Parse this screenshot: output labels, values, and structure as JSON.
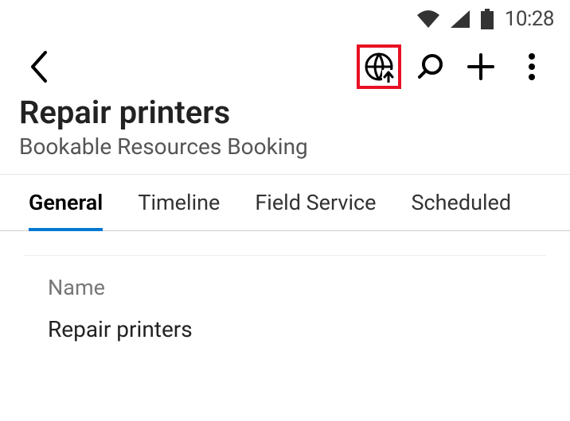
{
  "status_bar": {
    "time": "10:28"
  },
  "app_bar": {
    "icons": {
      "back": "back-icon",
      "sync": "globe-upload-icon",
      "search": "search-icon",
      "add": "plus-icon",
      "overflow": "overflow-icon"
    }
  },
  "header": {
    "title": "Repair printers",
    "subtitle": "Bookable Resources Booking"
  },
  "tabs": [
    {
      "label": "General",
      "active": true
    },
    {
      "label": "Timeline",
      "active": false
    },
    {
      "label": "Field Service",
      "active": false
    },
    {
      "label": "Scheduled",
      "active": false
    }
  ],
  "form": {
    "name_label": "Name",
    "name_value": "Repair printers"
  },
  "highlight": {
    "target": "sync-button",
    "color": "#e81123"
  }
}
